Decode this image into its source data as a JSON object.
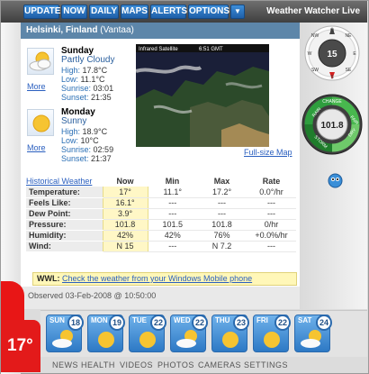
{
  "toolbar": {
    "buttons": [
      "UPDATE",
      "NOW",
      "DAILY",
      "MAPS",
      "ALERTS",
      "OPTIONS"
    ],
    "dropdown_icon": "chevron-down-icon",
    "app_title": "Weather Watcher Live"
  },
  "location": {
    "city": "Helsinki, Finland",
    "station": "(Vantaa)"
  },
  "current_temp": "17°",
  "days": [
    {
      "name": "Sunday",
      "condition": "Partly Cloudy",
      "icon": "partly-cloudy-icon",
      "high_label": "High:",
      "high": "17.8°C",
      "low_label": "Low:",
      "low": "11.1°C",
      "sunrise_label": "Sunrise:",
      "sunrise": "03:01",
      "sunset_label": "Sunset:",
      "sunset": "21:35",
      "more": "More"
    },
    {
      "name": "Monday",
      "condition": "Sunny",
      "icon": "sun-icon",
      "high_label": "High:",
      "high": "18.9°C",
      "low_label": "Low:",
      "low": "10°C",
      "sunrise_label": "Sunrise:",
      "sunrise": "02:59",
      "sunset_label": "Sunset:",
      "sunset": "21:37",
      "more": "More"
    }
  ],
  "map": {
    "caption": "Infrared Satellite",
    "time": "6:51 GMT",
    "link": "Full-size Map"
  },
  "compass": {
    "value": "15",
    "labels": [
      "N",
      "NE",
      "E",
      "SE",
      "S",
      "SW",
      "W",
      "NW"
    ]
  },
  "barometer": {
    "value": "101.8",
    "labels": [
      "RAIN",
      "CHANGE",
      "FAIR",
      "DRY",
      "STORM"
    ]
  },
  "table": {
    "header_link": "Historical Weather",
    "columns": [
      "Now",
      "Min",
      "Max",
      "Rate"
    ],
    "rows": [
      {
        "label": "Temperature:",
        "now": "17°",
        "min": "11.1°",
        "max": "17.2°",
        "rate": "0.0°/hr"
      },
      {
        "label": "Feels Like:",
        "now": "16.1°",
        "min": "---",
        "max": "---",
        "rate": "---"
      },
      {
        "label": "Dew Point:",
        "now": "3.9°",
        "min": "---",
        "max": "---",
        "rate": "---"
      },
      {
        "label": "Pressure:",
        "now": "101.8",
        "min": "101.5",
        "max": "101.8",
        "rate": "0/hr"
      },
      {
        "label": "Humidity:",
        "now": "42%",
        "min": "42%",
        "max": "76%",
        "rate": "+0.0%/hr"
      },
      {
        "label": "Wind:",
        "now": "N 15",
        "min": "---",
        "max": "N 7.2",
        "rate": "---"
      }
    ]
  },
  "wwl": {
    "prefix": "WWL:",
    "link": "Check the weather from your Windows Mobile phone"
  },
  "observed": "Observed 03-Feb-2008 @ 10:50:00",
  "forecast": [
    {
      "day": "SUN",
      "temp": "18",
      "icon": "partly-cloudy-icon"
    },
    {
      "day": "MON",
      "temp": "19",
      "icon": "sun-icon"
    },
    {
      "day": "TUE",
      "temp": "22",
      "icon": "sun-icon"
    },
    {
      "day": "WED",
      "temp": "22",
      "icon": "partly-cloudy-icon"
    },
    {
      "day": "THU",
      "temp": "23",
      "icon": "sun-icon"
    },
    {
      "day": "FRI",
      "temp": "22",
      "icon": "sun-icon"
    },
    {
      "day": "SAT",
      "temp": "24",
      "icon": "partly-cloudy-icon"
    }
  ],
  "bottom_links": [
    "NEWS",
    "HEALTH",
    "VIDEOS",
    "PHOTOS",
    "CAMERAS",
    "SETTINGS"
  ],
  "colors": {
    "accent_blue": "#2d79c5",
    "temp_red": "#e31a1a",
    "location_bar": "#5d86a9"
  }
}
